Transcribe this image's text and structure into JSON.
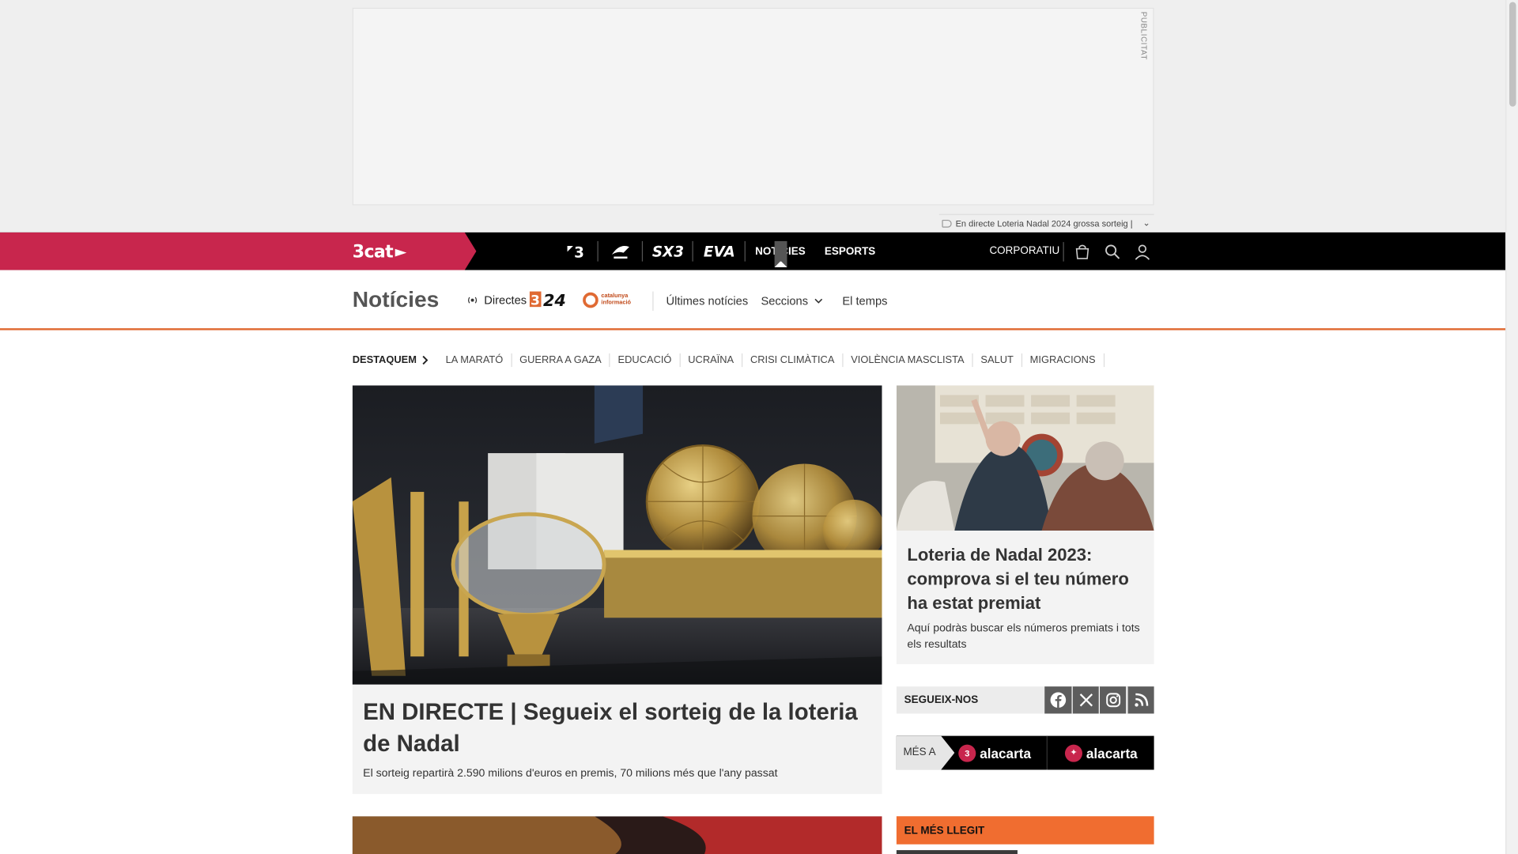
{
  "ad": {
    "label": "PUBLICITAT",
    "ticker_text": "En directe Loteria Nadal 2024 grossa sorteig |"
  },
  "topnav": {
    "brand": "3cat",
    "channels": [
      {
        "name": "3",
        "icon": "tv3-logo-icon"
      },
      {
        "name": "Cat ràdio",
        "icon": "catradio-logo-icon"
      },
      {
        "name": "SX3",
        "icon": "sx3-logo-icon"
      },
      {
        "name": "EVA",
        "icon": "eva-logo-icon"
      }
    ],
    "noticies": "NOTÍCIES",
    "esports": "ESPORTS",
    "corporatiu": "CORPORATIU"
  },
  "section": {
    "title": "Notícies",
    "directes": "Directes",
    "logo_324": "3/24",
    "logo_ci_line1": "catalunya",
    "logo_ci_line2": "informació",
    "ultimes": "Últimes notícies",
    "seccions": "Seccions",
    "el_temps": "El temps"
  },
  "tags": {
    "destaquem": "DESTAQUEM",
    "items": [
      "LA MARATÓ",
      "GUERRA A GAZA",
      "EDUCACIÓ",
      "UCRAÏNA",
      "CRISI CLIMÀTICA",
      "VIOLÈNCIA MASCLISTA",
      "SALUT",
      "MIGRACIONS"
    ]
  },
  "hero": {
    "title": "EN DIRECTE | Segueix el sorteig de la loteria de Nadal",
    "subtitle": "El sorteig repartirà 2.590 milions d'euros en premis, 70 milions més que l'any passat"
  },
  "side": {
    "title": "Loteria de Nadal 2023: comprova si el teu número ha estat premiat",
    "subtitle": "Aquí podràs buscar els números premiats i tots els resultats"
  },
  "follow": {
    "label": "SEGUEIX-NOS",
    "networks": [
      "facebook-icon",
      "x-icon",
      "instagram-icon",
      "rss-icon"
    ]
  },
  "mes": {
    "label": "MÉS A",
    "items": [
      "alacarta",
      "alacarta"
    ]
  },
  "most_read": {
    "label": "EL MÉS LLEGIT"
  },
  "colors": {
    "brand_red": "#c8264d",
    "accent_orange": "#f06d30",
    "nav_black": "#000000"
  }
}
